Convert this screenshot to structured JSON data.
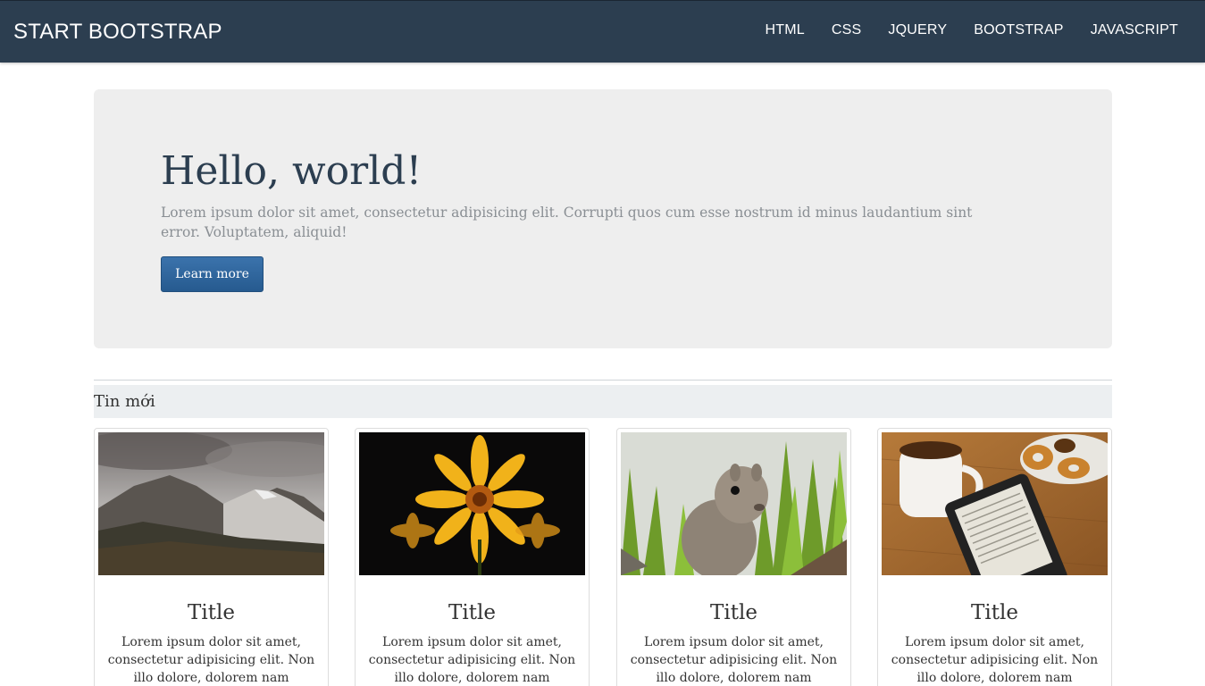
{
  "navbar": {
    "brand": "START BOOTSTRAP",
    "items": [
      "HTML",
      "CSS",
      "JQUERY",
      "BOOTSTRAP",
      "JAVASCRIPT"
    ]
  },
  "jumbotron": {
    "heading": "Hello, world!",
    "text": "Lorem ipsum dolor sit amet, consectetur adipisicing elit. Corrupti quos cum esse nostrum id minus laudantium sint error. Voluptatem, aliquid!",
    "button": "Learn more"
  },
  "section": {
    "title": "Tin mới"
  },
  "cards": [
    {
      "image": "mountain-photo",
      "title": "Title",
      "text": "Lorem ipsum dolor sit amet, consectetur adipisicing elit. Non illo dolore, dolorem nam"
    },
    {
      "image": "flower-photo",
      "title": "Title",
      "text": "Lorem ipsum dolor sit amet, consectetur adipisicing elit. Non illo dolore, dolorem nam"
    },
    {
      "image": "squirrel-photo",
      "title": "Title",
      "text": "Lorem ipsum dolor sit amet, consectetur adipisicing elit. Non illo dolore, dolorem nam"
    },
    {
      "image": "coffee-ereader-photo",
      "title": "Title",
      "text": "Lorem ipsum dolor sit amet, consectetur adipisicing elit. Non illo dolore, dolorem nam"
    }
  ],
  "colors": {
    "navbar": "#2c3e50",
    "button": "#2d6ca2",
    "jumbotron_bg": "#eeeeee"
  }
}
